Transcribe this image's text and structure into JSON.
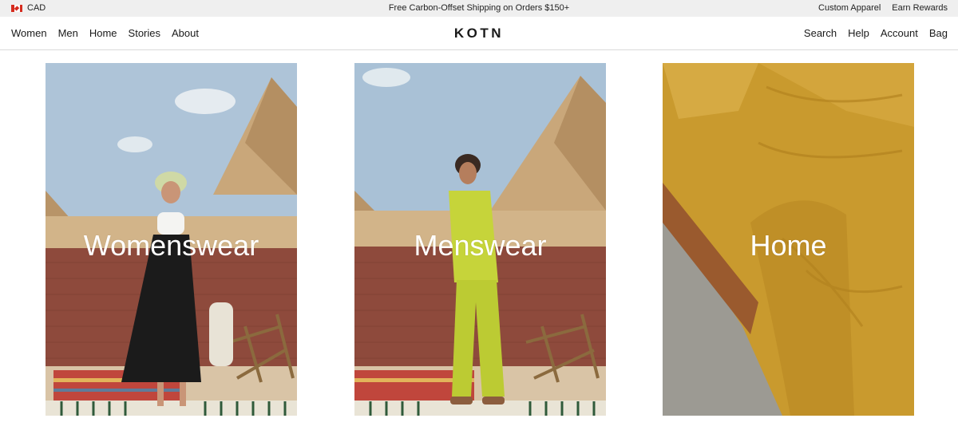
{
  "topbar": {
    "currency_icon": "canada-flag-icon",
    "currency": "CAD",
    "promo": "Free Carbon-Offset Shipping on Orders $150+",
    "links": [
      "Custom Apparel",
      "Earn Rewards"
    ]
  },
  "header": {
    "logo": "KOTN",
    "nav_left": [
      "Women",
      "Men",
      "Home",
      "Stories",
      "About"
    ],
    "nav_right": [
      "Search",
      "Help",
      "Account",
      "Bag"
    ]
  },
  "categories": [
    {
      "label": "Womenswear"
    },
    {
      "label": "Menswear"
    },
    {
      "label": "Home"
    }
  ],
  "colors": {
    "topbar_bg": "#efefef",
    "sky": "#a9c1d6",
    "pyramid": "#c9a77a",
    "brick": "#8e4a3c",
    "mens_outfit": "#c6d43a",
    "home_linen": "#c99a2e"
  }
}
